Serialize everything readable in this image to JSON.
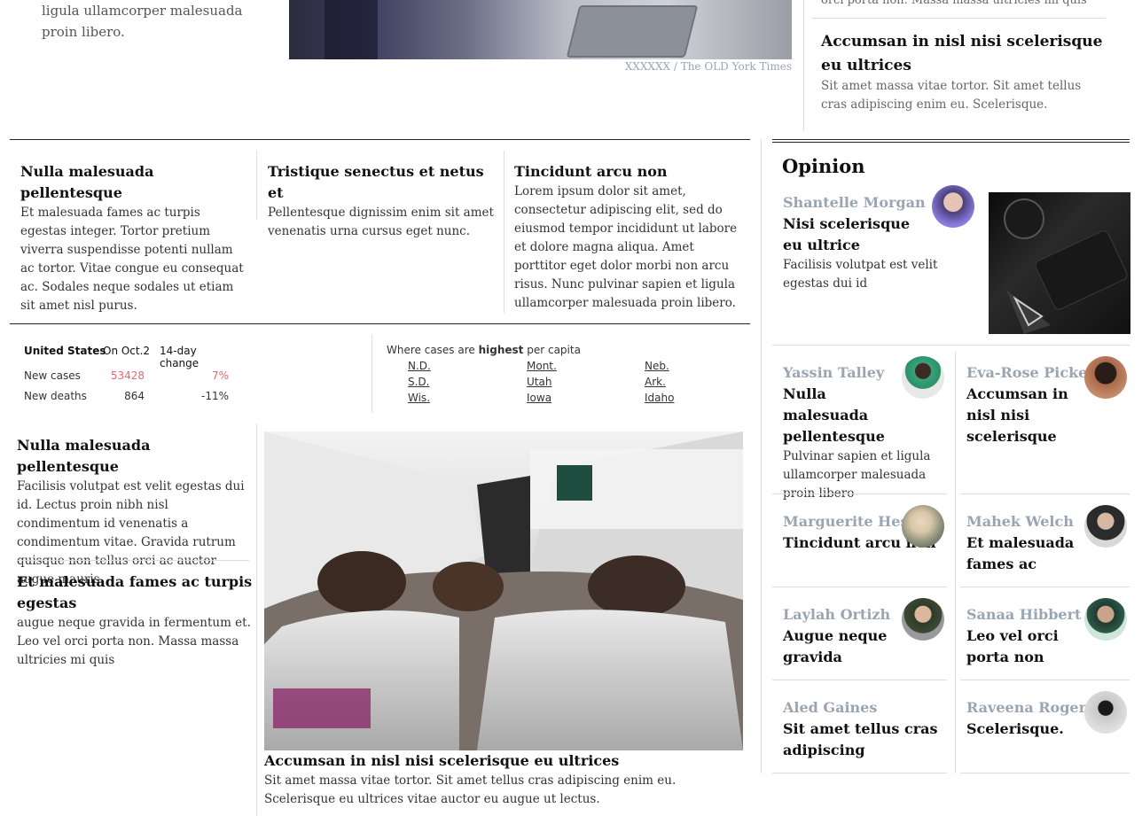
{
  "top": {
    "left_paragraph": "ligula ullamcorper malesuada proin libero.",
    "photo_caption": "XXXXXX / The OLD York Times",
    "right_partial_text": "orci porta non. Massa massa ultricies mi quis",
    "right_headline": "Accumsan in nisl nisi scelerisque eu ultrices",
    "right_summary": "Sit amet massa vitae tortor. Sit amet tellus cras adipiscing enim eu. Scelerisque."
  },
  "row_articles": [
    {
      "title": "Nulla malesuada pellentesque",
      "body": "Et malesuada fames ac turpis egestas integer. Tortor pretium viverra suspendisse potenti nullam ac tortor. Vitae congue eu consequat ac. Sodales neque sodales ut etiam sit amet nisl purus."
    },
    {
      "title": "Tristique senectus et netus et",
      "body": "Pellentesque dignissim enim sit amet venenatis urna cursus eget nunc."
    },
    {
      "title": "Tincidunt arcu non",
      "body": "Lorem ipsum dolor sit amet, consectetur adipiscing elit, sed do eiusmod tempor incididunt ut labore et dolore magna aliqua. Amet porttitor eget dolor morbi non arcu risus. Nunc pulvinar sapien et ligula ullamcorper malesuada proin libero."
    }
  ],
  "covid": {
    "col1": "United States",
    "col2": "On Oct.2",
    "col3": "14-day change",
    "rows": [
      {
        "label": "New cases",
        "value": "53428",
        "change": "7%"
      },
      {
        "label": "New deaths",
        "value": "864",
        "change": "-11%"
      }
    ],
    "highest_prefix": "Where cases are ",
    "highest_bold": "highest",
    "highest_suffix": " per capita",
    "states": [
      [
        "N.D.",
        "Mont.",
        "Neb."
      ],
      [
        "S.D.",
        "Utah",
        "Ark."
      ],
      [
        "Wis.",
        "Iowa",
        "Idaho"
      ]
    ],
    "colors": {
      "cases_red": "#e06b6b"
    }
  },
  "lower_left": [
    {
      "title": "Nulla malesuada pellentesque",
      "body": "Facilisis volutpat est velit egestas dui id. Lectus proin nibh nisl condimentum id venenatis a condimentum vitae. Gravida rutrum quisque non tellus orci ac auctor augue mauris."
    },
    {
      "title": "Et malesuada fames ac turpis egestas",
      "body": "augue neque gravida in fermentum et. Leo vel orci porta non. Massa massa ultricies mi quis"
    }
  ],
  "feature": {
    "title": "Accumsan in nisl nisi scelerisque eu ultrices",
    "body": "Sit amet massa vitae tortor. Sit amet tellus cras adipiscing enim eu. Scelerisque eu ultrices vitae auctor eu augue ut lectus."
  },
  "opinion": {
    "heading": "Opinion",
    "lead": {
      "author": "Shantelle Morgan",
      "title": "Nisi scelerisque eu ultrice",
      "body": "Facilisis volutpat est velit egestas dui id"
    },
    "items": [
      {
        "author": "Yassin Talley",
        "title": "Nulla malesuada pellentesque",
        "body": "Pulvinar sapien et ligula ullamcorper malesuada proin libero"
      },
      {
        "author": "Eva-Rose Pickett",
        "title": "Accumsan in nisl nisi scelerisque",
        "body": ""
      },
      {
        "author": "Marguerite Hester",
        "title": "Tincidunt arcu non",
        "body": ""
      },
      {
        "author": "Mahek Welch",
        "title": "Et malesuada fames ac",
        "body": ""
      },
      {
        "author": "Laylah Ortizh",
        "title": "Augue neque gravida",
        "body": ""
      },
      {
        "author": "Sanaa Hibbert",
        "title": "Leo vel orci porta non",
        "body": ""
      },
      {
        "author": "Aled Gaines",
        "title": "Sit amet tellus cras adipiscing",
        "body": ""
      },
      {
        "author": "Raveena Rogers",
        "title": "Scelerisque.",
        "body": ""
      }
    ]
  }
}
